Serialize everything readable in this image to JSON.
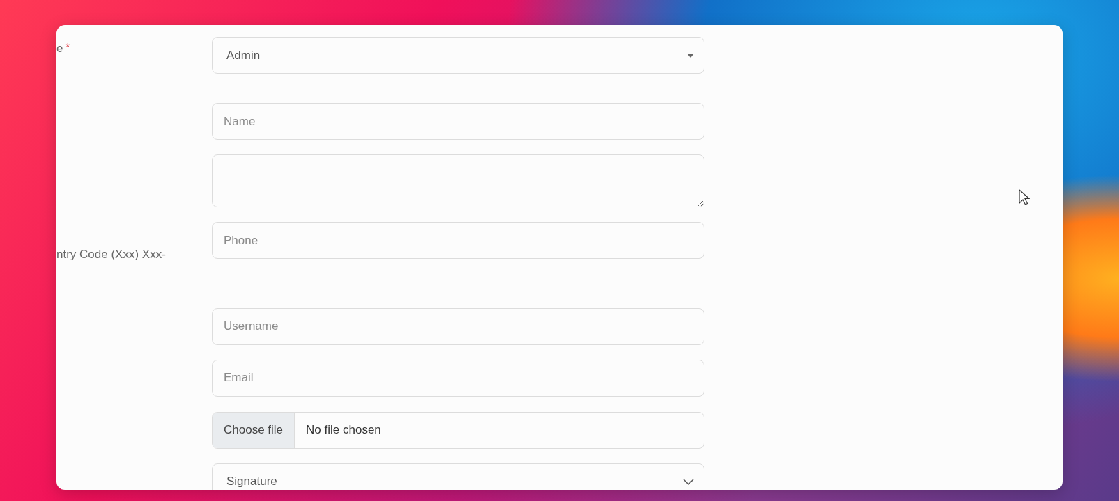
{
  "form": {
    "fields": [
      {
        "kind": "select",
        "label": "e",
        "required_mark": "*",
        "value": "Admin"
      },
      {
        "kind": "input",
        "placeholder": "Name"
      },
      {
        "kind": "textarea"
      },
      {
        "kind": "input",
        "label": "ntry Code (Xxx) Xxx-",
        "placeholder": "Phone"
      },
      {
        "kind": "input",
        "placeholder": "Username"
      },
      {
        "kind": "input",
        "placeholder": "Email"
      },
      {
        "kind": "file",
        "button": "Choose file",
        "status": "No file chosen"
      },
      {
        "kind": "dropdown",
        "value": "Signature"
      }
    ]
  }
}
